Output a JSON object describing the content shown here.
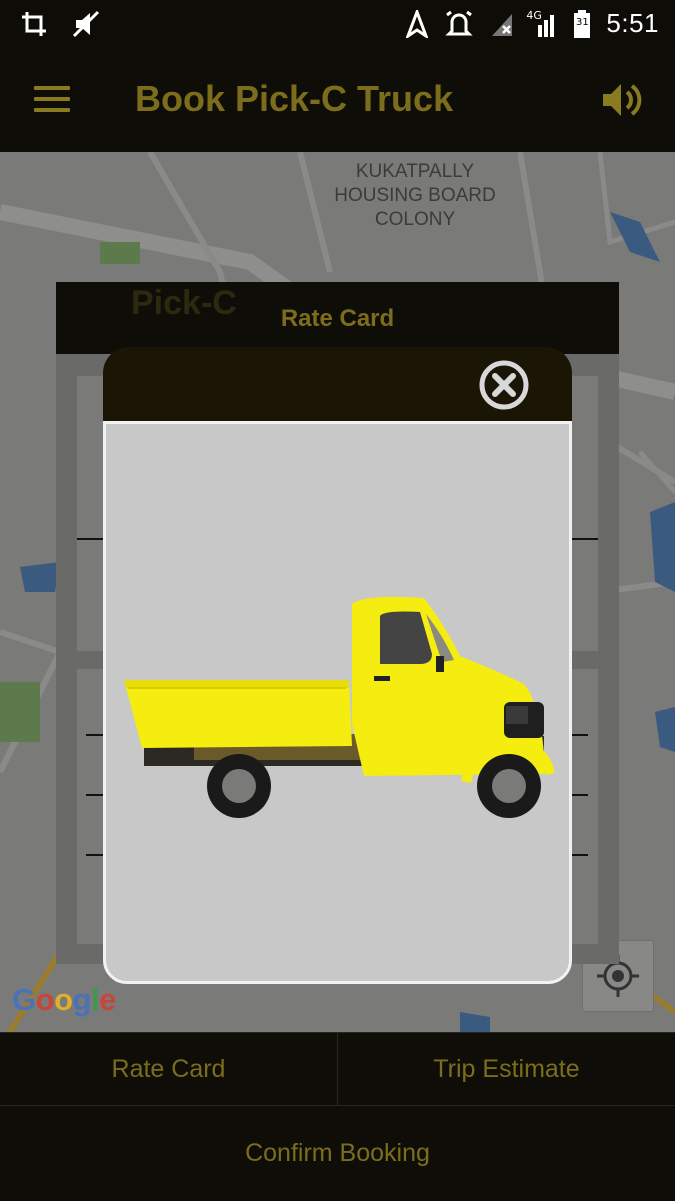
{
  "status_bar": {
    "time": "5:51",
    "network_label": "4G",
    "calendar_day": "31",
    "icons": [
      "crop-icon",
      "mute-icon",
      "navigation-icon",
      "alarm-icon",
      "signal-x-icon",
      "signal-4g-icon",
      "battery-icon"
    ]
  },
  "app_bar": {
    "title": "Book Pick-C Truck",
    "menu_icon": "hamburger-icon",
    "sound_icon": "speaker-icon"
  },
  "map": {
    "area_label": "KUKATPALLY HOUSING BOARD COLONY",
    "google_logo": "Google",
    "locate_icon": "my-location-icon"
  },
  "rate_card_panel": {
    "title": "Rate Card",
    "ghost_logo": "Pick-C"
  },
  "dialog": {
    "close_icon": "close-circle-icon",
    "image": "yellow-pickup-truck"
  },
  "bottom": {
    "rate_card_label": "Rate Card",
    "trip_estimate_label": "Trip Estimate",
    "confirm_label": "Confirm Booking"
  },
  "colors": {
    "accent": "#7c6d1c",
    "background": "#0f0d07",
    "dialog_body": "#c8c8c8",
    "truck": "#f5ec10"
  }
}
